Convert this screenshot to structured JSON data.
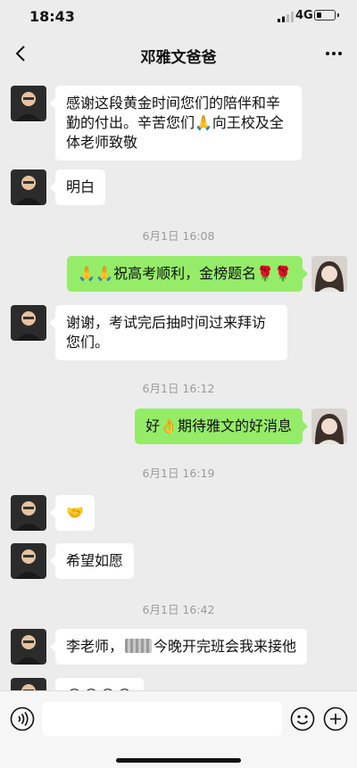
{
  "status_bar": {
    "time": "18:43",
    "network": "4G",
    "battery_level": 0.3
  },
  "header": {
    "title": "邓雅文爸爸"
  },
  "messages": [
    {
      "side": "left",
      "text": "感谢这段黄金时间您们的陪伴和辛勤的付出。辛苦您们🙏向王校及全体老师致敬"
    },
    {
      "side": "left",
      "text": "明白"
    },
    {
      "timestamp": "6月1日 16:08"
    },
    {
      "side": "right",
      "text": "🙏🙏祝高考顺利，金榜题名🌹🌹"
    },
    {
      "side": "left",
      "text": "谢谢，考试完后抽时间过来拜访您们。"
    },
    {
      "timestamp": "6月1日 16:12"
    },
    {
      "side": "right",
      "text": "好👌期待雅文的好消息"
    },
    {
      "timestamp": "6月1日 16:19"
    },
    {
      "side": "left",
      "text": "🤝"
    },
    {
      "side": "left",
      "text": "希望如愿"
    },
    {
      "timestamp": "6月1日 16:42"
    },
    {
      "side": "left",
      "text_before": "李老师，",
      "text_after": "今晚开完班会我来接他"
    },
    {
      "side": "left",
      "text": "😂😂😂😂"
    }
  ],
  "input": {
    "value": ""
  },
  "icons": {
    "back": "back-chevron-icon",
    "more": "more-dots-icon",
    "voice": "voice-icon",
    "emoji": "emoji-icon",
    "plus": "plus-icon"
  },
  "colors": {
    "sent_bubble": "#95ec69",
    "received_bubble": "#ffffff",
    "background": "#ececec"
  }
}
